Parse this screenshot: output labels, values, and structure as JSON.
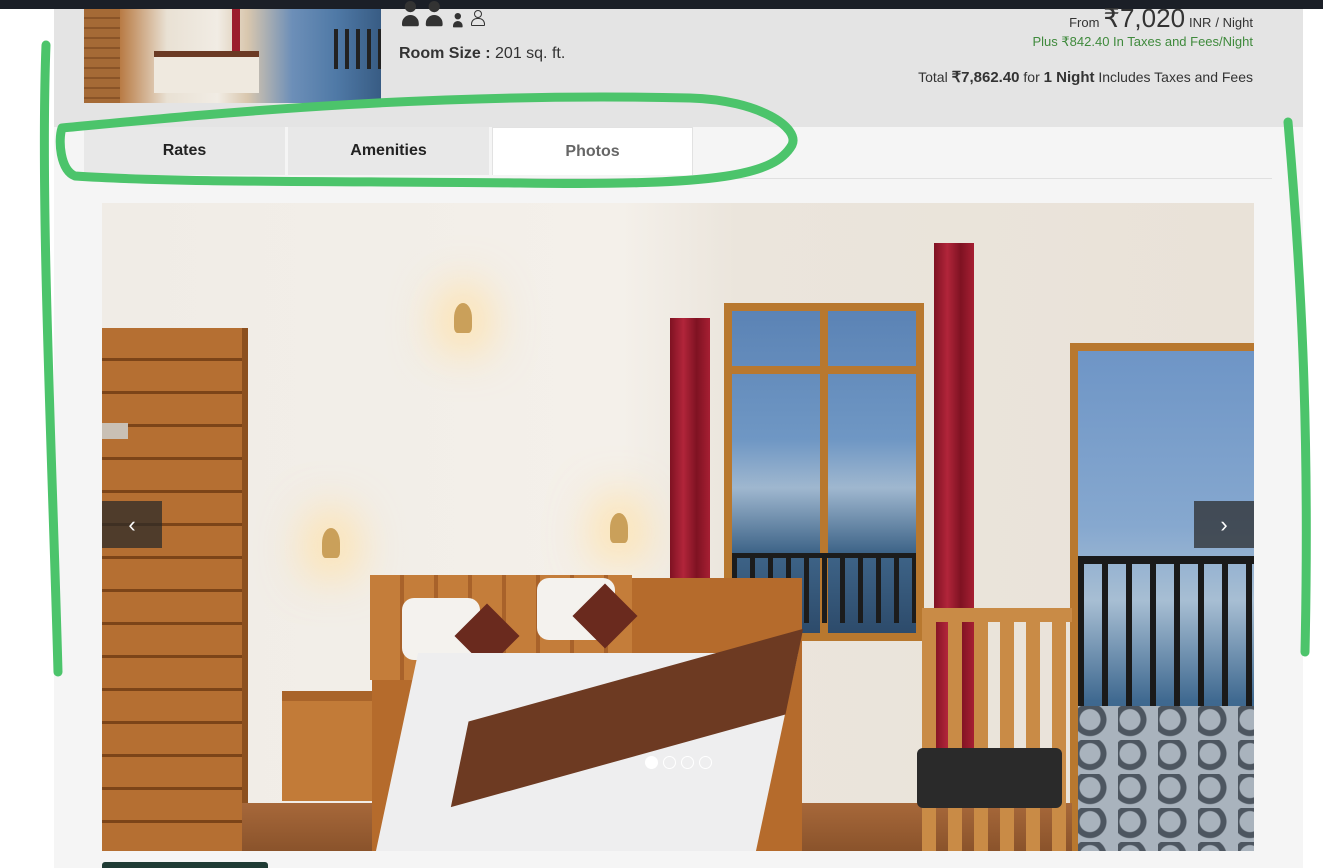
{
  "room": {
    "size_label": "Room Size :",
    "size_value": "201 sq. ft."
  },
  "pricing": {
    "from_label": "From",
    "amount": "₹7,020",
    "currency": "INR",
    "per": "/ Night",
    "taxes": "Plus ₹842.40 In Taxes and Fees/Night",
    "total_label": "Total",
    "total_amount": "₹7,862.40",
    "total_for": "for",
    "total_nights": "1 Night",
    "total_suffix": "Includes Taxes and Fees"
  },
  "tabs": [
    {
      "label": "Rates",
      "active": false
    },
    {
      "label": "Amenities",
      "active": false
    },
    {
      "label": "Photos",
      "active": true
    }
  ],
  "carousel": {
    "prev_icon": "chevron-left-icon",
    "next_icon": "chevron-right-icon",
    "prev_glyph": "‹",
    "next_glyph": "›",
    "slide_count": 4,
    "active_slide": 1
  },
  "colors": {
    "accent_green": "#3f8a3c",
    "annotation": "#4cc46b",
    "dark_button": "#1f3b34"
  }
}
